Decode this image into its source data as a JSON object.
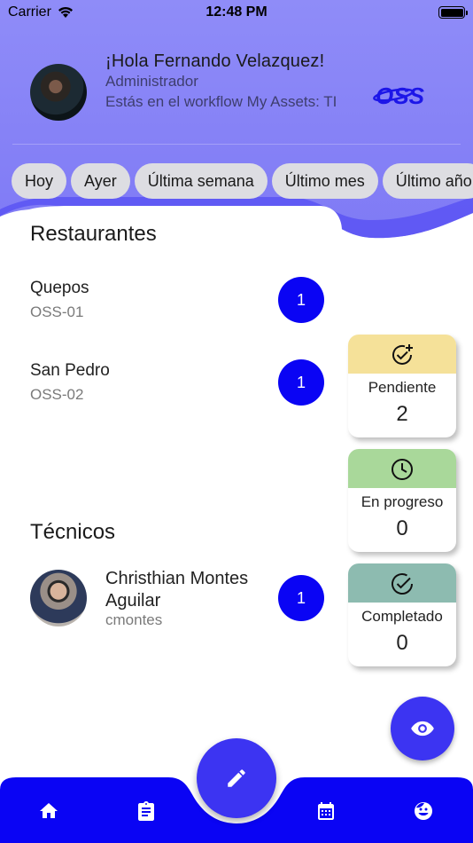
{
  "status_bar": {
    "carrier": "Carrier",
    "time": "12:48 PM"
  },
  "header": {
    "greeting": "¡Hola Fernando Velazquez!",
    "role": "Administrador",
    "workflow": "Estás en el workflow My Assets: TI",
    "logo_text": "OSS"
  },
  "filters": [
    "Hoy",
    "Ayer",
    "Última semana",
    "Último mes",
    "Último año"
  ],
  "restaurants": {
    "title": "Restaurantes",
    "items": [
      {
        "name": "Quepos",
        "code": "OSS-01",
        "count": "1"
      },
      {
        "name": "San Pedro",
        "code": "OSS-02",
        "count": "1"
      }
    ]
  },
  "technicians": {
    "title": "Técnicos",
    "items": [
      {
        "name": "Christhian Montes Aguilar",
        "user": "cmontes",
        "count": "1"
      }
    ]
  },
  "status_cards": [
    {
      "label": "Pendiente",
      "count": "2",
      "color": "#f5e199"
    },
    {
      "label": "En progreso",
      "count": "0",
      "color": "#a9d89a"
    },
    {
      "label": "Completado",
      "count": "0",
      "color": "#8dbbb0"
    }
  ],
  "colors": {
    "header": "#8c88f7",
    "accent": "#0a04f4",
    "fab": "#3c34f2"
  },
  "icons": {
    "view": "eye-icon",
    "edit": "pencil-icon",
    "home": "home-icon",
    "tasks": "clipboard-icon",
    "calendar": "calendar-icon",
    "profile": "face-icon"
  }
}
